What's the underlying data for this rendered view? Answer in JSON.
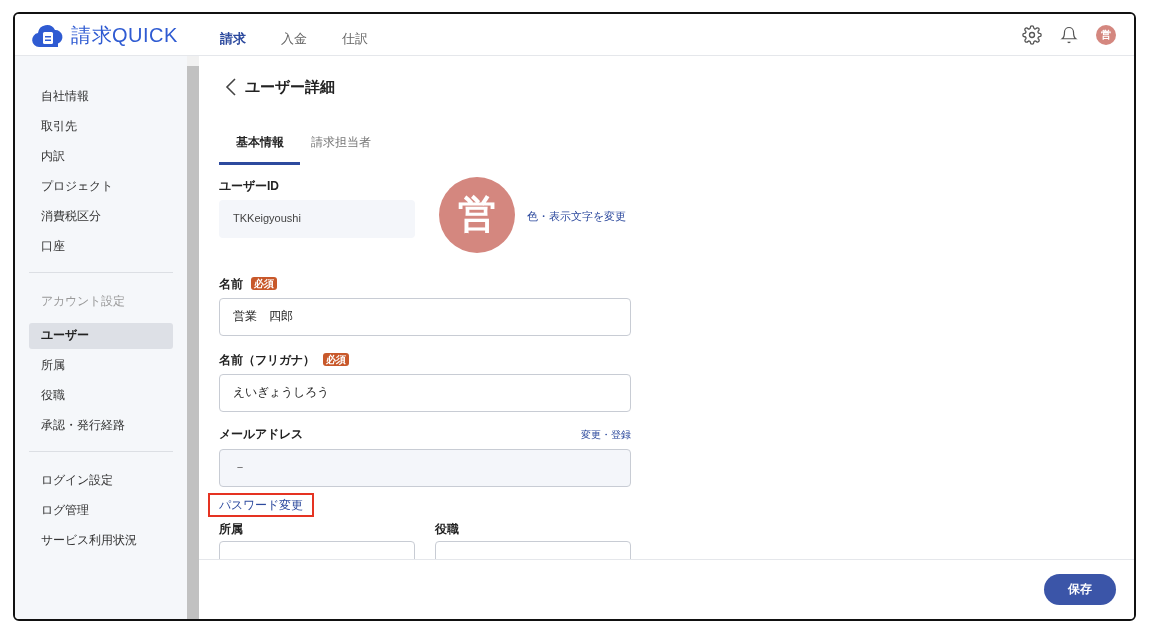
{
  "header": {
    "logo_text": "請求QUICK",
    "nav": [
      {
        "label": "請求",
        "selected": true
      },
      {
        "label": "入金",
        "selected": false
      },
      {
        "label": "仕訳",
        "selected": false
      }
    ],
    "avatar": "営"
  },
  "sidebar": {
    "groups": [
      {
        "items": [
          {
            "label": "自社情報",
            "selected": false
          },
          {
            "label": "取引先",
            "selected": false
          },
          {
            "label": "内訳",
            "selected": false
          },
          {
            "label": "プロジェクト",
            "selected": false
          },
          {
            "label": "消費税区分",
            "selected": false
          },
          {
            "label": "口座",
            "selected": false
          }
        ]
      },
      {
        "heading": "アカウント設定",
        "items": [
          {
            "label": "ユーザー",
            "selected": true
          },
          {
            "label": "所属",
            "selected": false
          },
          {
            "label": "役職",
            "selected": false
          },
          {
            "label": "承認・発行経路",
            "selected": false
          }
        ]
      },
      {
        "items": [
          {
            "label": "ログイン設定",
            "selected": false
          },
          {
            "label": "ログ管理",
            "selected": false
          },
          {
            "label": "サービス利用状況",
            "selected": false
          }
        ]
      }
    ]
  },
  "page": {
    "title": "ユーザー詳細",
    "tabs": [
      {
        "label": "基本情報",
        "selected": true
      },
      {
        "label": "請求担当者",
        "selected": false
      }
    ],
    "user_id": {
      "label": "ユーザーID",
      "value": "TKKeigyoushi"
    },
    "avatar": {
      "text": "営",
      "color": "#d4877f",
      "link": "色・表示文字を変更"
    },
    "name": {
      "label": "名前",
      "badge": "必須",
      "value": "営業　四郎"
    },
    "kana": {
      "label": "名前（フリガナ）",
      "badge": "必須",
      "value": "えいぎょうしろう"
    },
    "email": {
      "label": "メールアドレス",
      "link": "変更・登録",
      "value": "－"
    },
    "password_link": {
      "label": "パスワード変更",
      "highlighted": true
    },
    "bottom_fields": [
      {
        "label": "所属"
      },
      {
        "label": "役職"
      }
    ]
  },
  "footer": {
    "save": "保存"
  }
}
